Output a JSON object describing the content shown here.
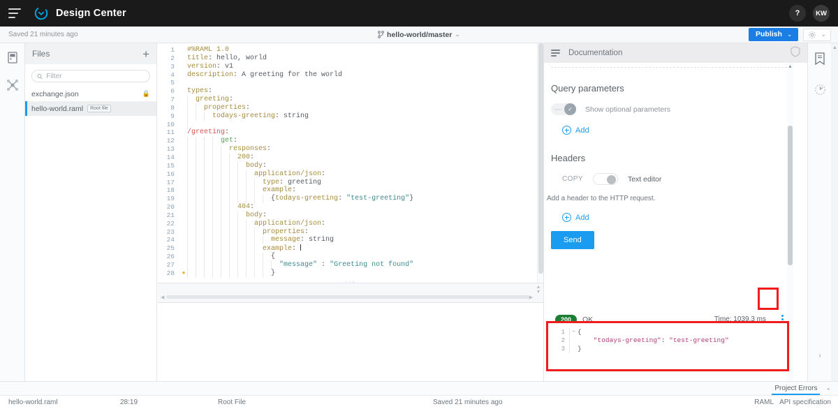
{
  "topbar": {
    "menu_icon": "hamburger-icon",
    "brand": "Design Center",
    "help_label": "?",
    "avatar_initials": "KW"
  },
  "subbar": {
    "saved_text": "Saved 21 minutes ago",
    "branch_label": "hello-world/master",
    "branch_caret": "⌄",
    "publish_label": "Publish",
    "publish_caret": "⌄",
    "gear_caret": "⌄",
    "publish_color": "#1a7ee5"
  },
  "left_rail": {
    "items": [
      {
        "name": "project-icon"
      },
      {
        "name": "dependencies-icon"
      }
    ],
    "collapse_label": "‹"
  },
  "files": {
    "title": "Files",
    "add_label": "+",
    "filter_placeholder": "Filter",
    "filter_value": "",
    "items": [
      {
        "label": "exchange.json",
        "badge": "",
        "locked": true,
        "selected": false
      },
      {
        "label": "hello-world.raml",
        "badge": "Root file",
        "locked": false,
        "selected": true
      }
    ]
  },
  "editor": {
    "ellipsis": "···",
    "lines": [
      {
        "n": 1,
        "indent": 0,
        "html": "<span class=\"k\">#%RAML 1.0</span>"
      },
      {
        "n": 2,
        "indent": 0,
        "html": "<span class=\"k\">title</span><span class=\"v\">: hello, world</span>"
      },
      {
        "n": 3,
        "indent": 0,
        "html": "<span class=\"k\">version</span><span class=\"v\">: v1</span>"
      },
      {
        "n": 4,
        "indent": 0,
        "html": "<span class=\"k\">description</span><span class=\"v\">: A greeting for the world</span>"
      },
      {
        "n": 5,
        "indent": 0,
        "html": ""
      },
      {
        "n": 6,
        "indent": 0,
        "html": "<span class=\"k\">types</span><span class=\"v\">:</span>"
      },
      {
        "n": 7,
        "indent": 1,
        "html": "<span class=\"k\">greeting</span><span class=\"v\">:</span>"
      },
      {
        "n": 8,
        "indent": 2,
        "html": "<span class=\"k\">properties</span><span class=\"v\">:</span>"
      },
      {
        "n": 9,
        "indent": 3,
        "html": "<span class=\"k\">todays-greeting</span><span class=\"v\">: string</span>"
      },
      {
        "n": 10,
        "indent": 1,
        "html": ""
      },
      {
        "n": 11,
        "indent": 0,
        "html": "<span class=\"res\">/greeting</span><span class=\"v\">:</span>"
      },
      {
        "n": 12,
        "indent": 4,
        "html": "<span class=\"meth\">get</span><span class=\"v\">:</span>"
      },
      {
        "n": 13,
        "indent": 5,
        "html": "<span class=\"k\">responses</span><span class=\"v\">:</span>"
      },
      {
        "n": 14,
        "indent": 6,
        "html": "<span class=\"num\">200</span><span class=\"v\">:</span>"
      },
      {
        "n": 15,
        "indent": 7,
        "html": "<span class=\"k\">body</span><span class=\"v\">:</span>"
      },
      {
        "n": 16,
        "indent": 8,
        "html": "<span class=\"k\">application/json</span><span class=\"v\">:</span>"
      },
      {
        "n": 17,
        "indent": 9,
        "html": "<span class=\"k\">type</span><span class=\"v\">: greeting</span>"
      },
      {
        "n": 18,
        "indent": 9,
        "html": "<span class=\"k\">example</span><span class=\"v\">:</span>"
      },
      {
        "n": 19,
        "indent": 10,
        "html": "<span class=\"v\">{</span><span class=\"k\">todays-greeting</span><span class=\"v\">: </span><span class=\"str\">\"test-greeting\"</span><span class=\"v\">}</span>"
      },
      {
        "n": 20,
        "indent": 6,
        "html": "<span class=\"num\">404</span><span class=\"v\">:</span>"
      },
      {
        "n": 21,
        "indent": 7,
        "html": "<span class=\"k\">body</span><span class=\"v\">:</span>"
      },
      {
        "n": 22,
        "indent": 8,
        "html": "<span class=\"k\">application/json</span><span class=\"v\">:</span>"
      },
      {
        "n": 23,
        "indent": 9,
        "html": "<span class=\"k\">properties</span><span class=\"v\">:</span>"
      },
      {
        "n": 24,
        "indent": 10,
        "html": "<span class=\"k\">message</span><span class=\"v\">: string</span>"
      },
      {
        "n": 25,
        "indent": 9,
        "html": "<span class=\"k\">example</span><span class=\"v\">: </span><span class=\"caret-line\"></span>"
      },
      {
        "n": 26,
        "indent": 10,
        "html": "<span class=\"v\">{</span>"
      },
      {
        "n": 27,
        "indent": 11,
        "html": "<span class=\"str\">\"message\"</span><span class=\"v\"> : </span><span class=\"str\">\"Greeting not found\"</span>"
      },
      {
        "n": 28,
        "indent": 10,
        "html": "<span class=\"v\">}</span>",
        "bulb": true
      }
    ]
  },
  "documentation": {
    "title": "Documentation",
    "menu_icon": "list-icon",
    "shield_icon": "shield-icon",
    "query_parameters_title": "Query parameters",
    "show_optional_label": "Show optional parameters",
    "show_optional_on": true,
    "query_add_label": "Add",
    "headers_title": "Headers",
    "copy_label": "COPY",
    "text_editor_label": "Text editor",
    "text_editor_on": false,
    "header_hint": "Add a header to the HTTP request.",
    "headers_add_label": "Add",
    "send_label": "Send",
    "status_code": "200",
    "status_text": "OK",
    "time_label": "Time: 1039.3 ms",
    "kebab_icon": "more-vertical-icon",
    "accent_color": "#1a9cf0",
    "status_color": "#1e7d34",
    "highlight_color": "#ee1c1c"
  },
  "response": {
    "lines": [
      {
        "n": 1,
        "fold": "−",
        "html": "<span class=\"rpunct\">{</span>"
      },
      {
        "n": 2,
        "fold": "",
        "html": "<span class=\"rstr\">    \"todays-greeting\"</span><span class=\"rpunct\">: </span><span class=\"rstr\">\"test-greeting\"</span>"
      },
      {
        "n": 3,
        "fold": "",
        "html": "<span class=\"rpunct\">}</span>"
      }
    ]
  },
  "right_rail": {
    "items": [
      {
        "name": "api-notebook-icon"
      },
      {
        "name": "mocking-service-icon"
      }
    ],
    "expand_label": "›"
  },
  "errorbar": {
    "tab_label": "Project Errors",
    "caret": "⌃"
  },
  "statusbar": {
    "file": "hello-world.raml",
    "position": "28:19",
    "root": "Root File",
    "saved": "Saved 21 minutes ago",
    "lang": "RAML",
    "spec": "API specification"
  }
}
